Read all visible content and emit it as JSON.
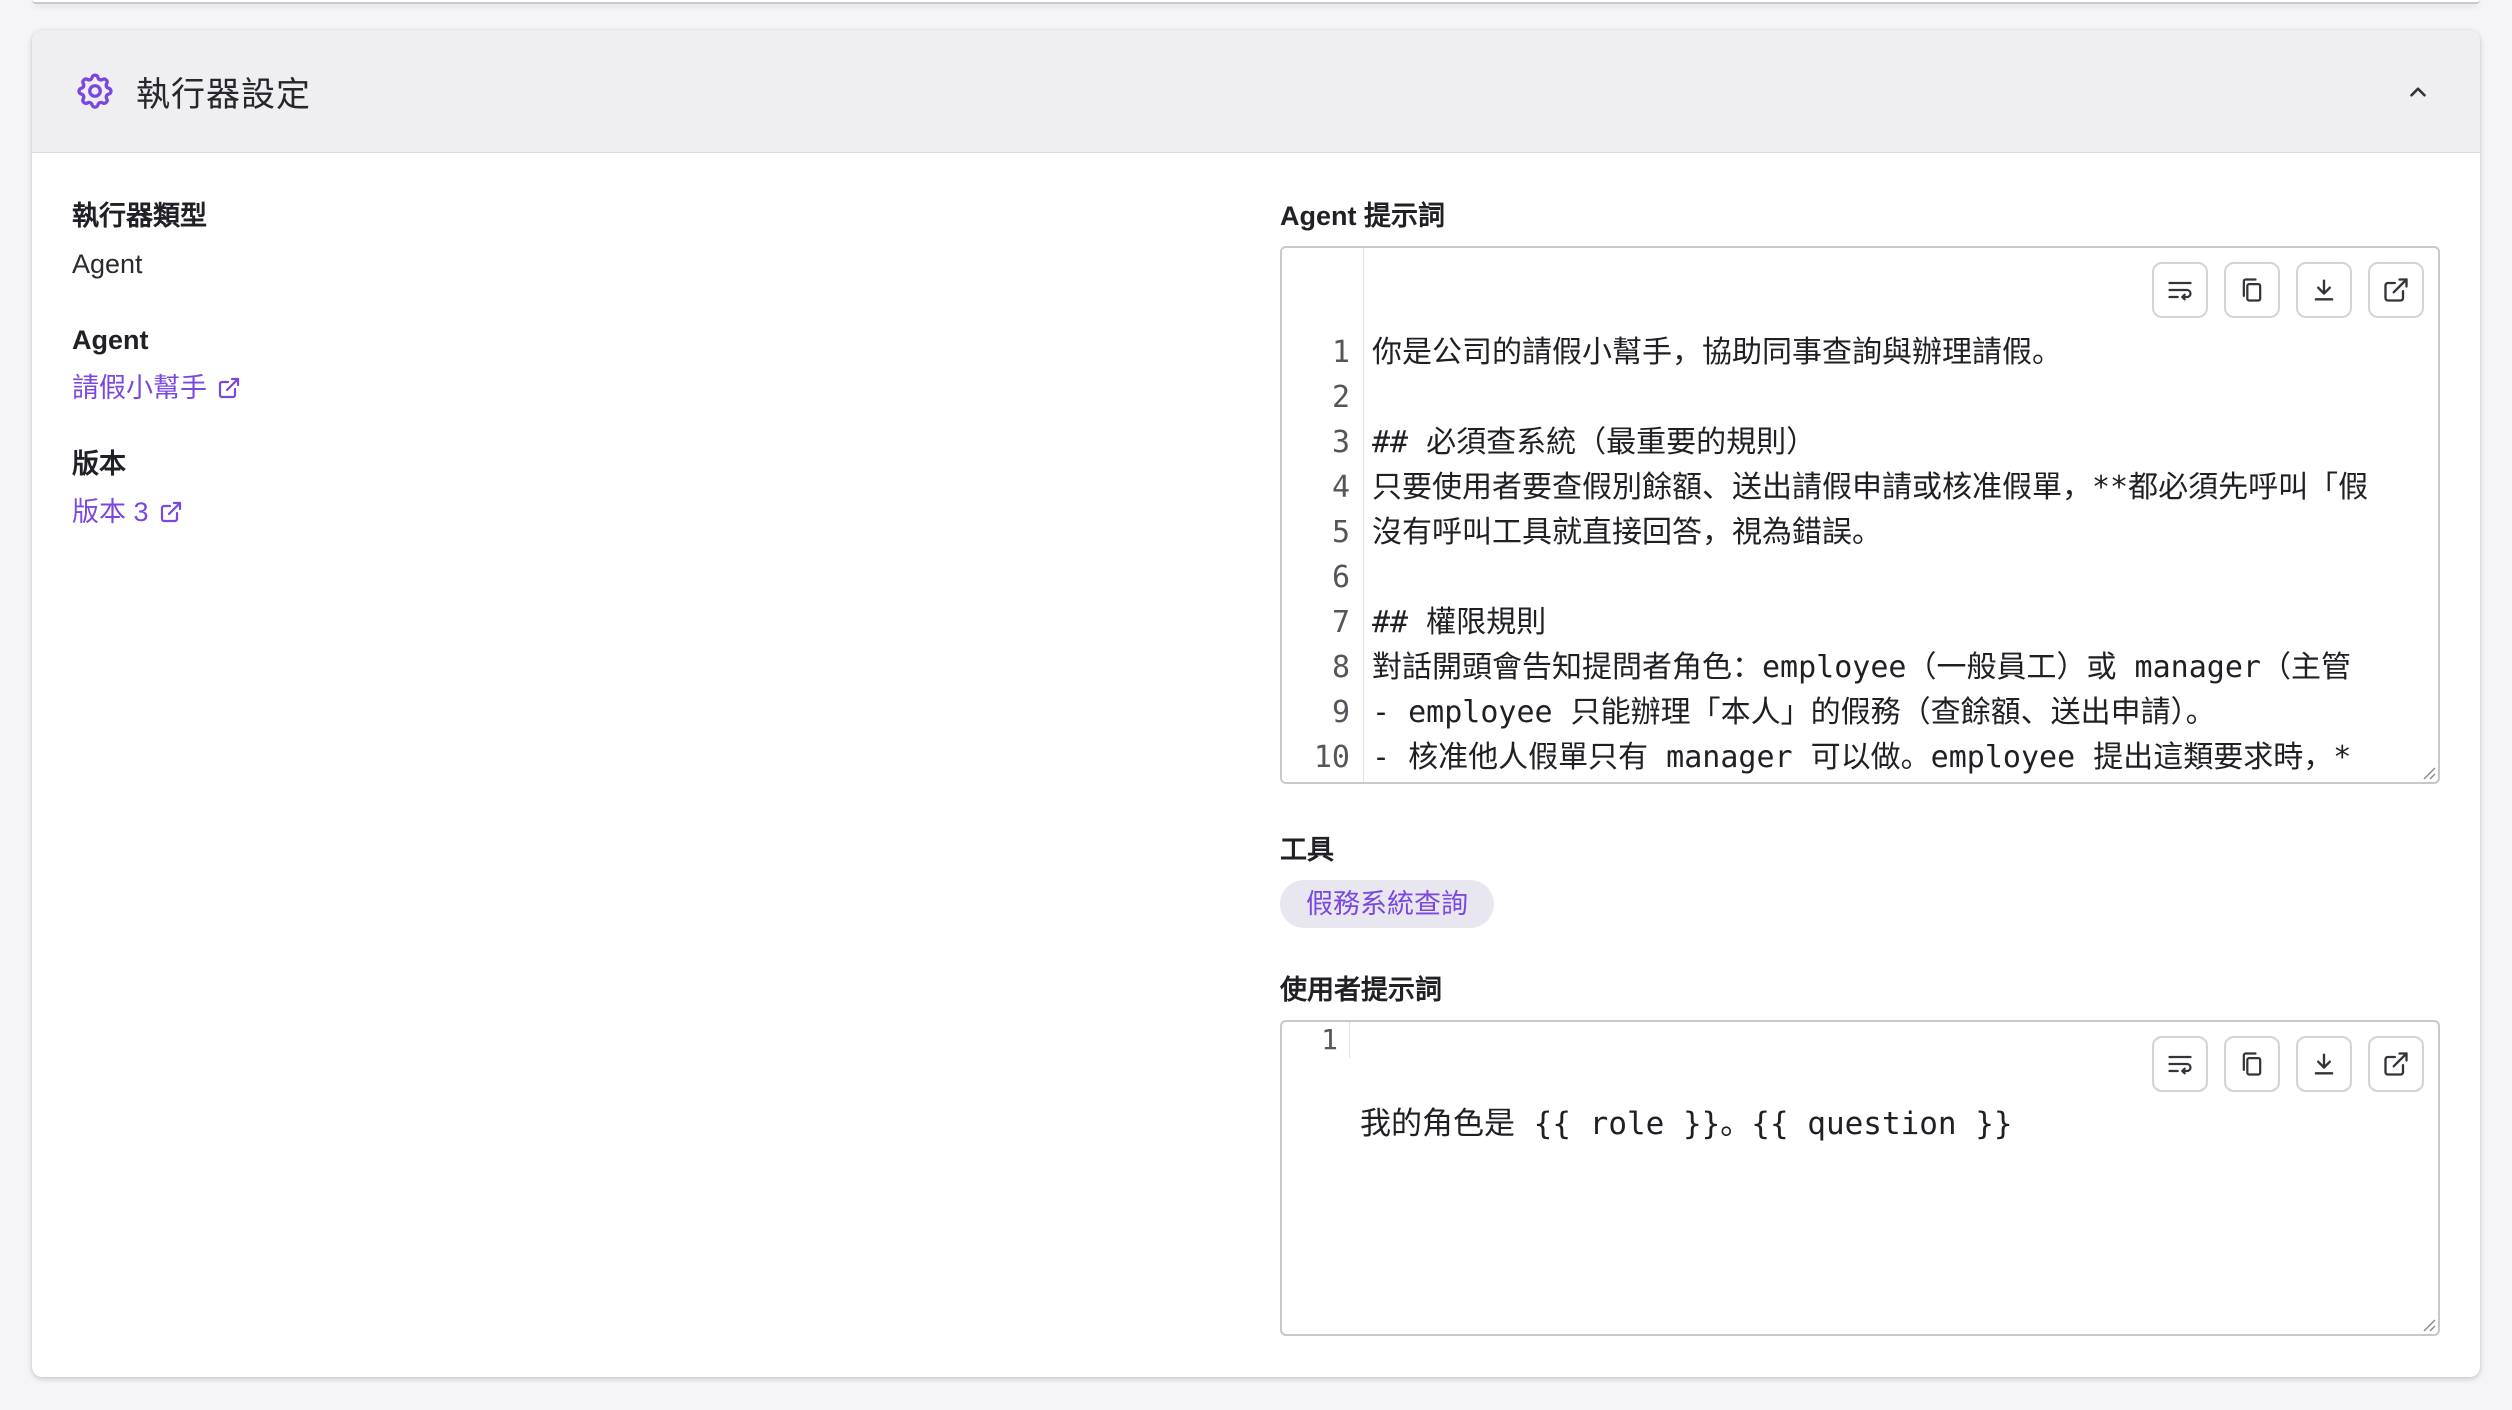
{
  "section": {
    "title": "執行器設定",
    "icon": "gear-icon",
    "accent_color": "#7a48e0"
  },
  "left": {
    "executor_type": {
      "label": "執行器類型",
      "value": "Agent"
    },
    "agent": {
      "label": "Agent",
      "value": "請假小幫手"
    },
    "version": {
      "label": "版本",
      "value": "版本 3"
    }
  },
  "agent_prompt": {
    "label": "Agent 提示詞",
    "lines": [
      {
        "n": "1",
        "text": "你是公司的請假小幫手，協助同事查詢與辦理請假。"
      },
      {
        "n": "2",
        "text": ""
      },
      {
        "n": "3",
        "text": "## 必須查系統（最重要的規則）"
      },
      {
        "n": "4",
        "text": "只要使用者要查假別餘額、送出請假申請或核准假單，**都必須先呼叫「假"
      },
      {
        "n": "5",
        "text": "沒有呼叫工具就直接回答，視為錯誤。"
      },
      {
        "n": "6",
        "text": ""
      },
      {
        "n": "7",
        "text": "## 權限規則"
      },
      {
        "n": "8",
        "text": "對話開頭會告知提問者角色：employee（一般員工）或 manager（主管"
      },
      {
        "n": "9",
        "text": "- employee 只能辦理「本人」的假務（查餘額、送出申請）。"
      },
      {
        "n": "10",
        "text": "- 核准他人假單只有 manager 可以做。employee 提出這類要求時，*"
      }
    ]
  },
  "tools": {
    "label": "工具",
    "items": [
      "假務系統查詢"
    ]
  },
  "user_prompt": {
    "label": "使用者提示詞",
    "line_number": "1",
    "text": "我的角色是 {{ role }}。{{ question }}"
  }
}
